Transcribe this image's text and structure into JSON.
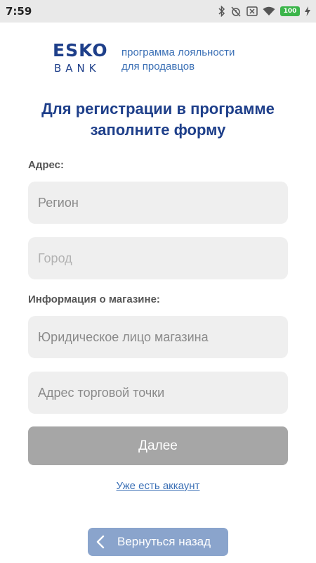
{
  "status_bar": {
    "time": "7:59",
    "battery": "100"
  },
  "logo": {
    "brand": "ESKO",
    "sub": "BANK"
  },
  "program": {
    "line1": "программа лояльности",
    "line2": "для продавцов"
  },
  "title": {
    "line1": "Для регистрации в программе",
    "line2": "заполните форму"
  },
  "address_section": {
    "label": "Адрес:",
    "region_placeholder": "Регион",
    "city_placeholder": "Город"
  },
  "store_section": {
    "label": "Информация о магазине:",
    "legal_entity_placeholder": "Юридическое лицо магазина",
    "store_address_placeholder": "Адрес торговой точки"
  },
  "next_button": "Далее",
  "account_link": "Уже есть аккаунт",
  "back_button": "Вернуться назад",
  "colors": {
    "brand": "#1e3f8a",
    "link": "#3a6fb5",
    "button_disabled": "#a6a6a6",
    "back_button": "#8aa4cc"
  }
}
